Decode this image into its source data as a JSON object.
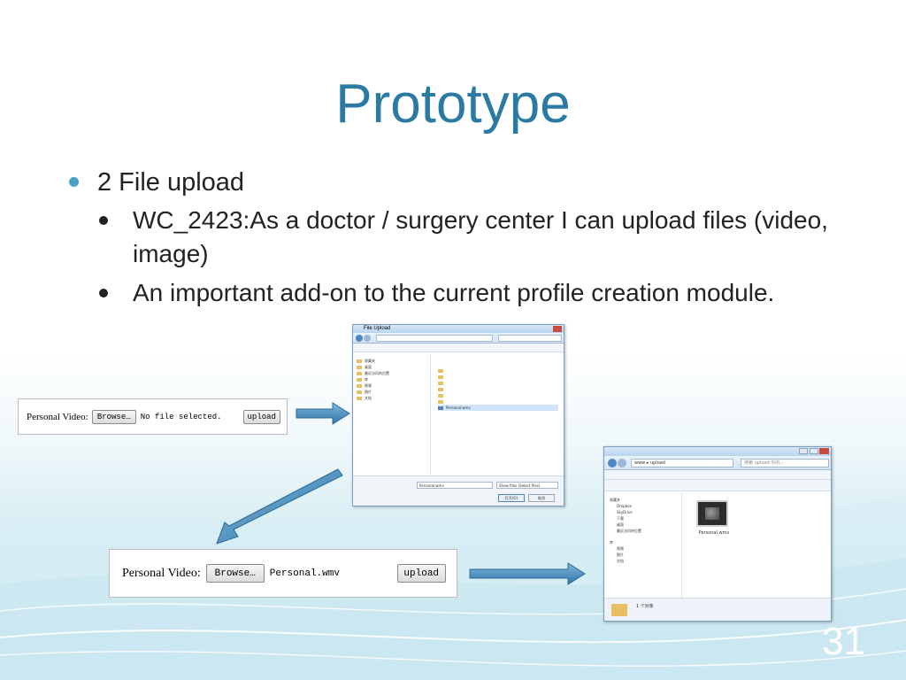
{
  "slide": {
    "title": "Prototype",
    "bullet_level1": "2 File upload",
    "bullets_level2": [
      "WC_2423:As a doctor / surgery center I can upload files (video, image)",
      "An important add-on to the current profile creation module."
    ],
    "page_number": "31"
  },
  "form_before": {
    "label": "Personal Video:",
    "browse_label": "Browse…",
    "status": "No file selected.",
    "upload_label": "upload"
  },
  "form_after": {
    "label": "Personal Video:",
    "browse_label": "Browse…",
    "filename": "Personal.wmv",
    "upload_label": "upload"
  },
  "file_dialog": {
    "title": "File Upload",
    "filename_value": "Personal.wmv",
    "filter_value": "Show files (Select files)",
    "open_label": "打开(O)",
    "cancel_label": "取消",
    "selected_file": "Personal.wmv"
  },
  "explorer": {
    "path": "www ▸ upload",
    "search_placeholder": "搜索 upload 中的...",
    "nav_items": [
      "收藏夹",
      "Dropbox",
      "SkyDrive",
      "下载",
      "桌面",
      "最近访问的位置",
      "库",
      "视频",
      "图片",
      "文档"
    ],
    "file_name": "Personal.wmv",
    "status": "1 个对象"
  },
  "colors": {
    "title": "#2b7aa3",
    "bullet_level1": "#4aa3c6",
    "arrow": "#3f86b8",
    "page_number": "#ffffff"
  }
}
